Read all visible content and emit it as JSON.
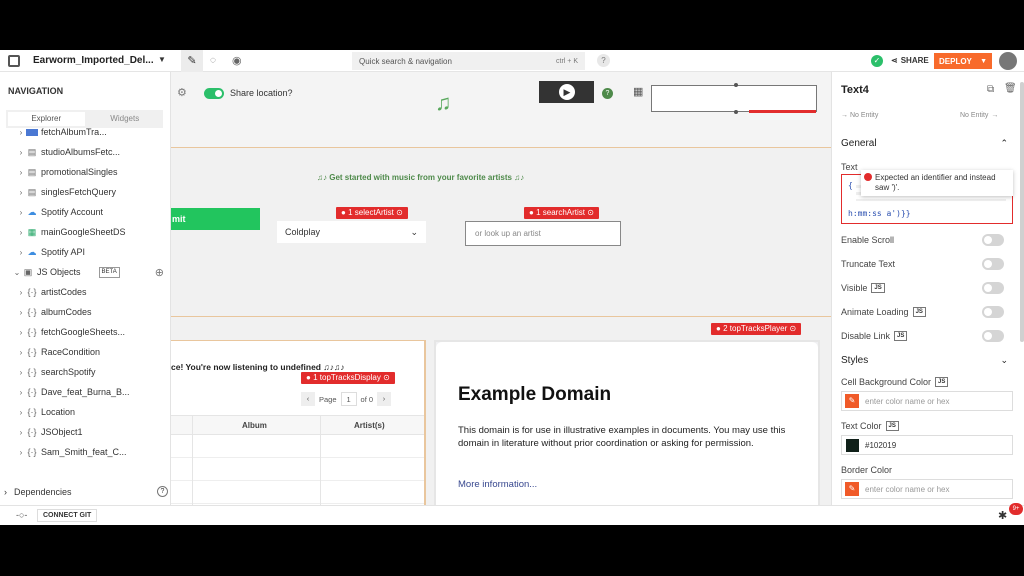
{
  "topbar": {
    "app_name": "Earworm_Imported_Del...",
    "search_placeholder": "Quick search & navigation",
    "search_shortcut": "ctrl + K",
    "help": "?",
    "share": "SHARE",
    "deploy": "DEPLOY"
  },
  "nav": {
    "title": "NAVIGATION",
    "tabs": [
      "Explorer",
      "Widgets"
    ],
    "items": [
      {
        "label": "fetchAlbumTra...",
        "icon": "api"
      },
      {
        "label": "studioAlbumsFetc...",
        "icon": "query"
      },
      {
        "label": "promotionalSingles",
        "icon": "query"
      },
      {
        "label": "singlesFetchQuery",
        "icon": "query"
      },
      {
        "label": "Spotify Account",
        "icon": "cloud"
      },
      {
        "label": "mainGoogleSheetDS",
        "icon": "sheet"
      },
      {
        "label": "Spotify API",
        "icon": "cloud"
      }
    ],
    "js_objects_label": "JS Objects",
    "beta": "BETA",
    "js_items": [
      "artistCodes",
      "albumCodes",
      "fetchGoogleSheets...",
      "RaceCondition",
      "searchSpotify",
      "Dave_feat_Burna_B...",
      "Location",
      "JSObject1",
      "Sam_Smith_feat_C..."
    ],
    "dependencies": "Dependencies"
  },
  "bottombar": {
    "connect_git": "CONNECT GIT",
    "badge": "9+"
  },
  "canvas": {
    "share_location": "Share location?",
    "get_started": "♫♪ Get started with music from your favorite artists ♫♪",
    "submit_partial": "mit",
    "select_value": "Coldplay",
    "search_placeholder": "or look up an artist",
    "listening_text": "ce! You're now listening to undefined ♫♪♫♪",
    "page_label": "Page",
    "page_number": "1",
    "page_of": "of 0",
    "table_headers": [
      "Album",
      "Artist(s)"
    ],
    "tags": {
      "select_artist": "selectArtist",
      "search_artist": "searchArtist",
      "top_tracks_player": "topTracksPlayer",
      "top_tracks_display": "topTracksDisplay"
    },
    "tag_counts": {
      "select_artist": "1",
      "search_artist": "1",
      "top_tracks_player": "2",
      "top_tracks_display": "1"
    },
    "iframe": {
      "title": "Example Domain",
      "body": "This domain is for use in illustrative examples in documents. You may use this domain in literature without prior coordination or asking for permission.",
      "link": "More information..."
    }
  },
  "props": {
    "widget_name": "Text4",
    "no_entity_left": "→ No Entity",
    "no_entity_right": "No Entity",
    "general": "General",
    "text_label": "Text",
    "code_line1": "{",
    "code_line2": "h:mm:ss a')}}",
    "error": "Expected an identifier and instead saw ')'.",
    "toggles": [
      "Enable Scroll",
      "Truncate Text",
      "Visible",
      "Animate Loading",
      "Disable Link"
    ],
    "js_flags": [
      "",
      "",
      "JS",
      "JS",
      "JS"
    ],
    "styles": "Styles",
    "cell_bg_label": "Cell Background Color",
    "text_color_label": "Text Color",
    "text_color_value": "#102019",
    "border_color_label": "Border Color",
    "color_placeholder": "enter color name or hex"
  },
  "colors": {
    "accent": "#f86a2b",
    "tag": "#e22c2c",
    "green": "#2bbf6a",
    "highlight_border": "#e9c69d"
  }
}
